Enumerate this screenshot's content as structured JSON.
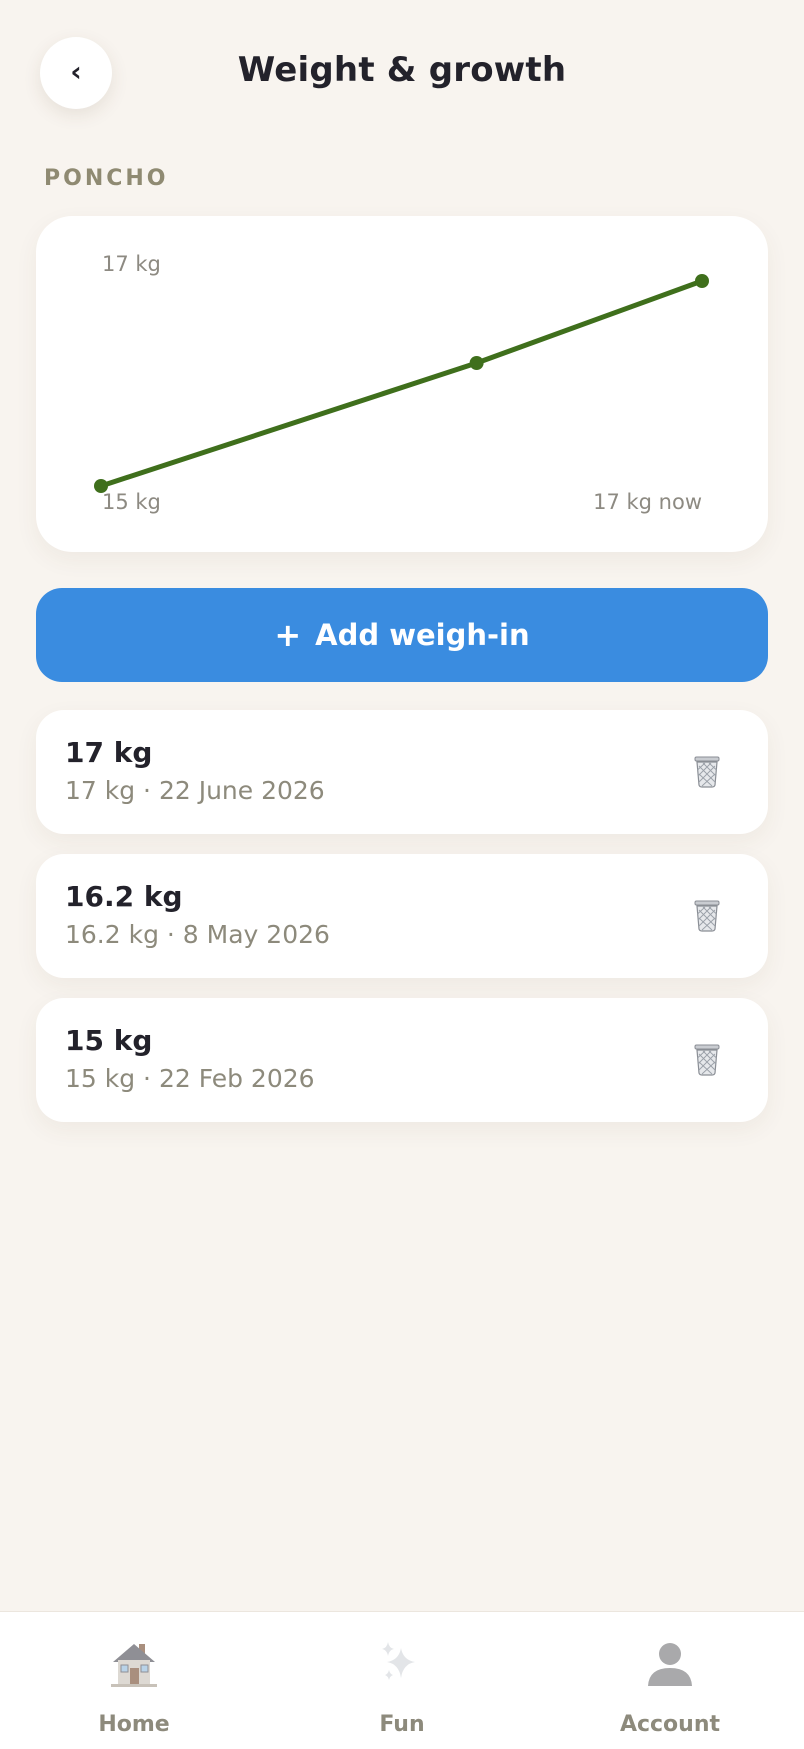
{
  "header": {
    "back_label": "‹",
    "title": "Weight & growth"
  },
  "pet": {
    "name": "PONCHO"
  },
  "chart_data": {
    "type": "line",
    "x": [
      "22 Feb 2026",
      "8 May 2026",
      "22 June 2026"
    ],
    "series": [
      {
        "values": [
          15,
          16.2,
          17
        ],
        "color": "#3f6f1c"
      }
    ],
    "ylim": [
      15,
      17
    ],
    "unit": "kg",
    "labels": {
      "top": "17 kg",
      "bottom_left": "15 kg",
      "bottom_right": "17 kg now"
    },
    "grid": false,
    "legend": "none"
  },
  "actions": {
    "add_icon": "+",
    "add_label": "Add weigh-in"
  },
  "entries": [
    {
      "weight": "17 kg",
      "detail": "17 kg · 22 June 2026",
      "icon": "trash-icon"
    },
    {
      "weight": "16.2 kg",
      "detail": "16.2 kg · 8 May 2026",
      "icon": "trash-icon"
    },
    {
      "weight": "15 kg",
      "detail": "15 kg · 22 Feb 2026",
      "icon": "trash-icon"
    }
  ],
  "nav": {
    "items": [
      {
        "label": "Home",
        "icon": "house-icon"
      },
      {
        "label": "Fun",
        "icon": "sparkles-icon"
      },
      {
        "label": "Account",
        "icon": "user-icon"
      }
    ]
  },
  "colors": {
    "background": "#f8f4ef",
    "accent": "#3a8ce0",
    "line": "#3f6f1c",
    "muted_text": "#8d8a7c"
  }
}
